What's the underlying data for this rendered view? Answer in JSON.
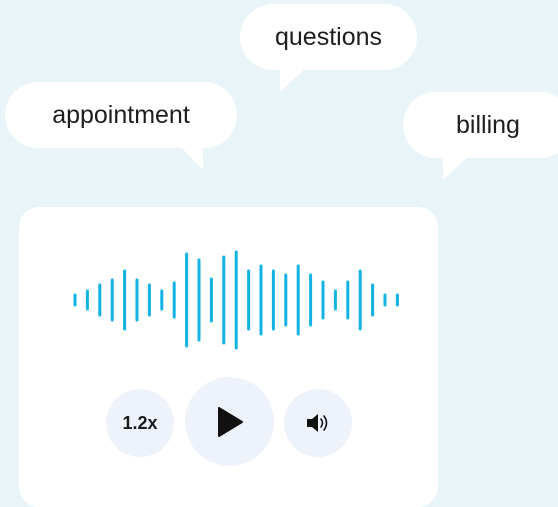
{
  "bubbles": {
    "appointment": "appointment",
    "questions": "questions",
    "billing": "billing"
  },
  "player": {
    "speed_label": "1.2x",
    "play_icon": "play-icon",
    "volume_icon": "volume-icon",
    "waveform_icon": "audio-waveform",
    "accent_color": "#13b3e6",
    "control_bg": "#eef2fa"
  },
  "colors": {
    "background": "#e9f4f8",
    "card": "#ffffff",
    "text": "#1e1e1e"
  }
}
